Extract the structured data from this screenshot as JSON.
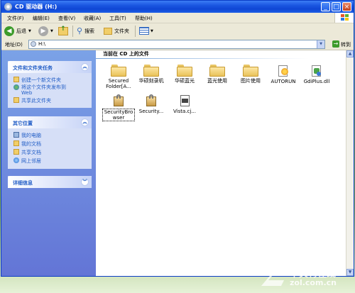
{
  "window": {
    "title": "CD 驱动器 (H:)",
    "min": "_",
    "max": "□",
    "close": "×"
  },
  "menu": [
    "文件(F)",
    "编辑(E)",
    "查看(V)",
    "收藏(A)",
    "工具(T)",
    "帮助(H)"
  ],
  "toolbar": {
    "back": "后退",
    "search": "搜索",
    "folders": "文件夹"
  },
  "address": {
    "label": "地址(D)",
    "value": "H:\\",
    "go": "转到"
  },
  "left_pane": {
    "tasks": {
      "title": "文件和文件夹任务",
      "items": [
        "创建一个新文件夹",
        "将这个文件夹发布到\nWeb",
        "共享此文件夹"
      ]
    },
    "other": {
      "title": "其它位置",
      "items": [
        "我的电脑",
        "我的文档",
        "共享文档",
        "网上邻居"
      ]
    },
    "details": {
      "title": "详细信息"
    }
  },
  "content": {
    "heading": "当前在 CD 上的文件",
    "files": [
      {
        "name": "Secured\nFolder[A...",
        "type": "folder"
      },
      {
        "name": "华硕刻录机",
        "type": "folder"
      },
      {
        "name": "华硕蓝光",
        "type": "folder"
      },
      {
        "name": "蓝光使用",
        "type": "folder"
      },
      {
        "name": "图片使用",
        "type": "folder"
      },
      {
        "name": "AUTORUN",
        "type": "autorun"
      },
      {
        "name": "GdiPlus.dll",
        "type": "dll"
      },
      {
        "name": "SecurityBro\nwser",
        "type": "app"
      },
      {
        "name": "Security...",
        "type": "app"
      },
      {
        "name": "Vista.cj...",
        "type": "file"
      }
    ]
  },
  "watermark": {
    "line1": "中关村在线",
    "line2": "zol.com.cn"
  },
  "colors": {
    "title_blue": "#0f46d4",
    "pane_blue": "#6375d6",
    "link_blue": "#215dc6"
  }
}
